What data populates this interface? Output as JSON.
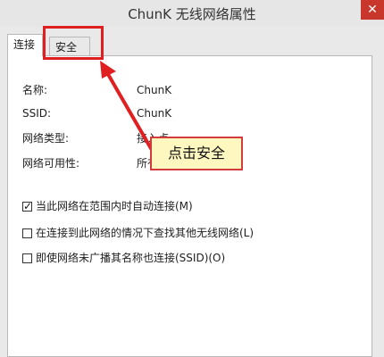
{
  "window": {
    "title": "ChunK 无线网络属性",
    "close_glyph": "✕"
  },
  "tabs": [
    {
      "label": "连接",
      "active": true
    },
    {
      "label": "安全",
      "active": false
    }
  ],
  "fields": [
    {
      "label": "名称:",
      "value": "ChunK"
    },
    {
      "label": "SSID:",
      "value": "ChunK"
    },
    {
      "label": "网络类型:",
      "value": "接入点"
    },
    {
      "label": "网络可用性:",
      "value": "所有"
    }
  ],
  "options": [
    {
      "label": "当此网络在范围内时自动连接(M)",
      "checked": true
    },
    {
      "label": "在连接到此网络的情况下查找其他无线网络(L)",
      "checked": false
    },
    {
      "label": "即使网络未广播其名称也连接(SSID)(O)",
      "checked": false
    }
  ],
  "annotation": {
    "text": "点击安全",
    "color": "#e02020"
  }
}
